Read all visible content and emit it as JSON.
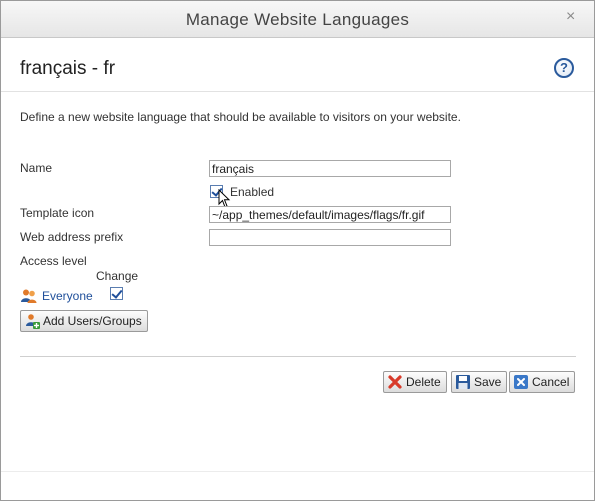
{
  "dialog": {
    "title": "Manage Website Languages",
    "close_glyph": "×",
    "help_glyph": "?"
  },
  "page_title": "français - fr",
  "description": "Define a new website language that should be available to visitors on your website.",
  "form": {
    "name_label": "Name",
    "name_value": "français",
    "enabled_label": "Enabled",
    "enabled_checked": true,
    "template_icon_label": "Template icon",
    "template_icon_value": "~/app_themes/default/images/flags/fr.gif",
    "web_prefix_label": "Web address prefix",
    "web_prefix_value": "",
    "access_level_label": "Access level",
    "access_change_header": "Change",
    "access_rows": [
      {
        "name": "Everyone",
        "change_checked": true
      }
    ]
  },
  "buttons": {
    "add_users_groups": "Add Users/Groups",
    "delete": "Delete",
    "save": "Save",
    "cancel": "Cancel"
  },
  "icons": {
    "close": "close-icon",
    "help": "help-icon",
    "group": "user-group-icon",
    "add_users": "add-user-group-icon",
    "delete": "red-x-icon",
    "save": "floppy-disk-icon",
    "cancel": "cancel-x-icon"
  },
  "colors": {
    "link": "#1f4f9a",
    "delete_icon": "#d83a2a",
    "save_icon": "#2a5a9c",
    "cancel_icon": "#3a78c8"
  }
}
